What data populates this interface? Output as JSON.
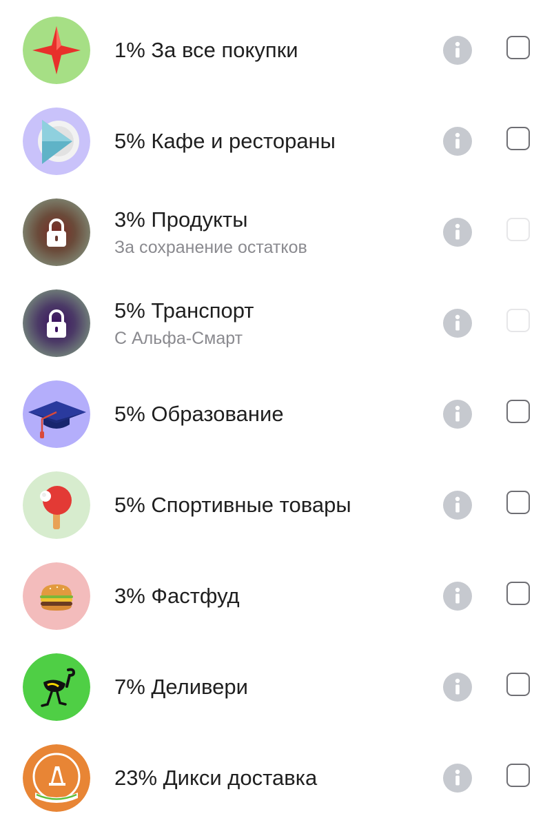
{
  "categories": [
    {
      "title": "1% За все покупки",
      "subtitle": "",
      "icon": "red-star-icon",
      "bg": "#a6df85",
      "locked": false,
      "checkbox_enabled": true
    },
    {
      "title": "5% Кафе и рестораны",
      "subtitle": "",
      "icon": "play-plate-icon",
      "bg": "#c9c2fa",
      "locked": false,
      "checkbox_enabled": true
    },
    {
      "title": "3% Продукты",
      "subtitle": "За сохранение остатков",
      "icon": "lock-icon",
      "bg": "#6b6a58",
      "locked": true,
      "checkbox_enabled": false
    },
    {
      "title": "5% Транспорт",
      "subtitle": "С Альфа-Смарт",
      "icon": "lock-icon",
      "bg": "#5a5870",
      "locked": true,
      "checkbox_enabled": false
    },
    {
      "title": "5% Образование",
      "subtitle": "",
      "icon": "graduation-cap-icon",
      "bg": "#b4aefb",
      "locked": false,
      "checkbox_enabled": true
    },
    {
      "title": "5% Спортивные товары",
      "subtitle": "",
      "icon": "ping-pong-paddle-icon",
      "bg": "#d7ecce",
      "locked": false,
      "checkbox_enabled": true
    },
    {
      "title": "3% Фастфуд",
      "subtitle": "",
      "icon": "burger-icon",
      "bg": "#f3bcbc",
      "locked": false,
      "checkbox_enabled": true
    },
    {
      "title": "7% Деливери",
      "subtitle": "",
      "icon": "ostrich-logo-icon",
      "bg": "#4fcf45",
      "locked": false,
      "checkbox_enabled": true
    },
    {
      "title": "23% Дикси доставка",
      "subtitle": "",
      "icon": "dixy-logo-icon",
      "bg": "#e88535",
      "locked": false,
      "checkbox_enabled": true
    }
  ],
  "colors": {
    "info_icon": "#c6c9cf",
    "checkbox_border": "#6e6e73",
    "checkbox_disabled_border": "#e6e6e8",
    "subtitle_text": "#8a8a8f"
  }
}
